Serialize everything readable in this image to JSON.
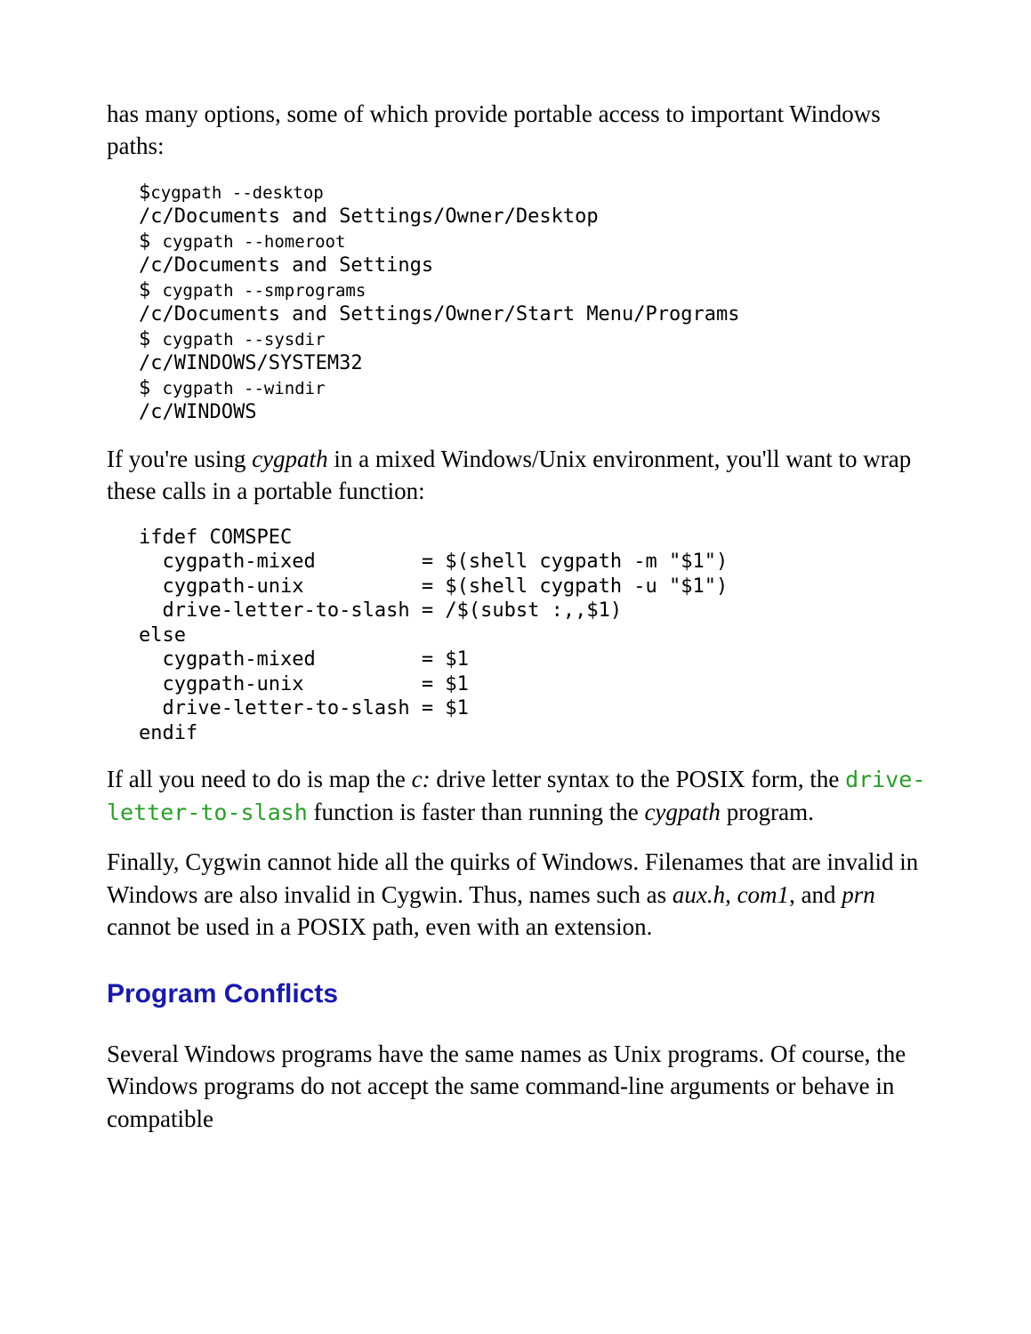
{
  "para1_a": "has many options, some of which provide portable access to important Windows paths:",
  "code1": "$cygpath --desktop\n/c/Documents and Settings/Owner/Desktop\n$ cygpath --homeroot\n/c/Documents and Settings\n$ cygpath --smprograms\n/c/Documents and Settings/Owner/Start Menu/Programs\n$ cygpath --sysdir\n/c/WINDOWS/SYSTEM32\n$ cygpath --windir\n/c/WINDOWS",
  "para2_a": "If you're using ",
  "para2_b": "cygpath",
  "para2_c": " in a mixed Windows/Unix environment, you'll want to wrap these calls in a portable function:",
  "code2": "ifdef COMSPEC\n  cygpath-mixed         = $(shell cygpath -m \"$1\")\n  cygpath-unix          = $(shell cygpath -u \"$1\")\n  drive-letter-to-slash = /$(subst :,,$1)\nelse\n  cygpath-mixed         = $1\n  cygpath-unix          = $1\n  drive-letter-to-slash = $1\nendif",
  "para3_a": "If all you need to do is map the ",
  "para3_b": "c:",
  "para3_c": " drive letter syntax to the POSIX form, the ",
  "para3_d": "drive-letter-to-slash",
  "para3_e": " function is faster than running the ",
  "para3_f": "cygpath",
  "para3_g": " program.",
  "para4_a": "Finally, Cygwin cannot hide all the quirks of Windows. Filenames that are invalid in Windows are also invalid in Cygwin. Thus, names such as ",
  "para4_b": "aux.h",
  "para4_c": ", ",
  "para4_d": "com1",
  "para4_e": ", and ",
  "para4_f": "prn",
  "para4_g": " cannot be used in a POSIX path, even with an extension.",
  "heading1": "Program Conflicts",
  "para5": "Several Windows programs have the same names as Unix programs. Of course, the Windows programs do not accept the same command-line arguments or behave in compatible"
}
